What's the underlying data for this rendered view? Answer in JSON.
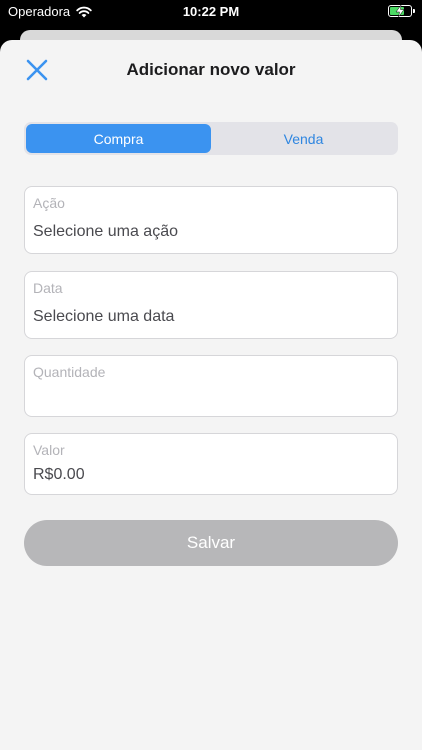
{
  "status_bar": {
    "carrier": "Operadora",
    "time": "10:22 PM"
  },
  "nav": {
    "title": "Adicionar novo valor"
  },
  "segmented": {
    "items": [
      {
        "label": "Compra"
      },
      {
        "label": "Venda"
      }
    ],
    "selected": "Compra"
  },
  "form": {
    "acao": {
      "label": "Ação",
      "value": "Selecione uma ação"
    },
    "data": {
      "label": "Data",
      "value": "Selecione uma data"
    },
    "quantidade": {
      "label": "Quantidade",
      "value": ""
    },
    "valor": {
      "label": "Valor",
      "value": "R$0.00"
    }
  },
  "save_button": {
    "label": "Salvar"
  },
  "colors": {
    "accent": "#3b93f0",
    "sheet": "#f4f4f4",
    "disabled": "#b7b7b9",
    "battery": "#4cd964"
  }
}
